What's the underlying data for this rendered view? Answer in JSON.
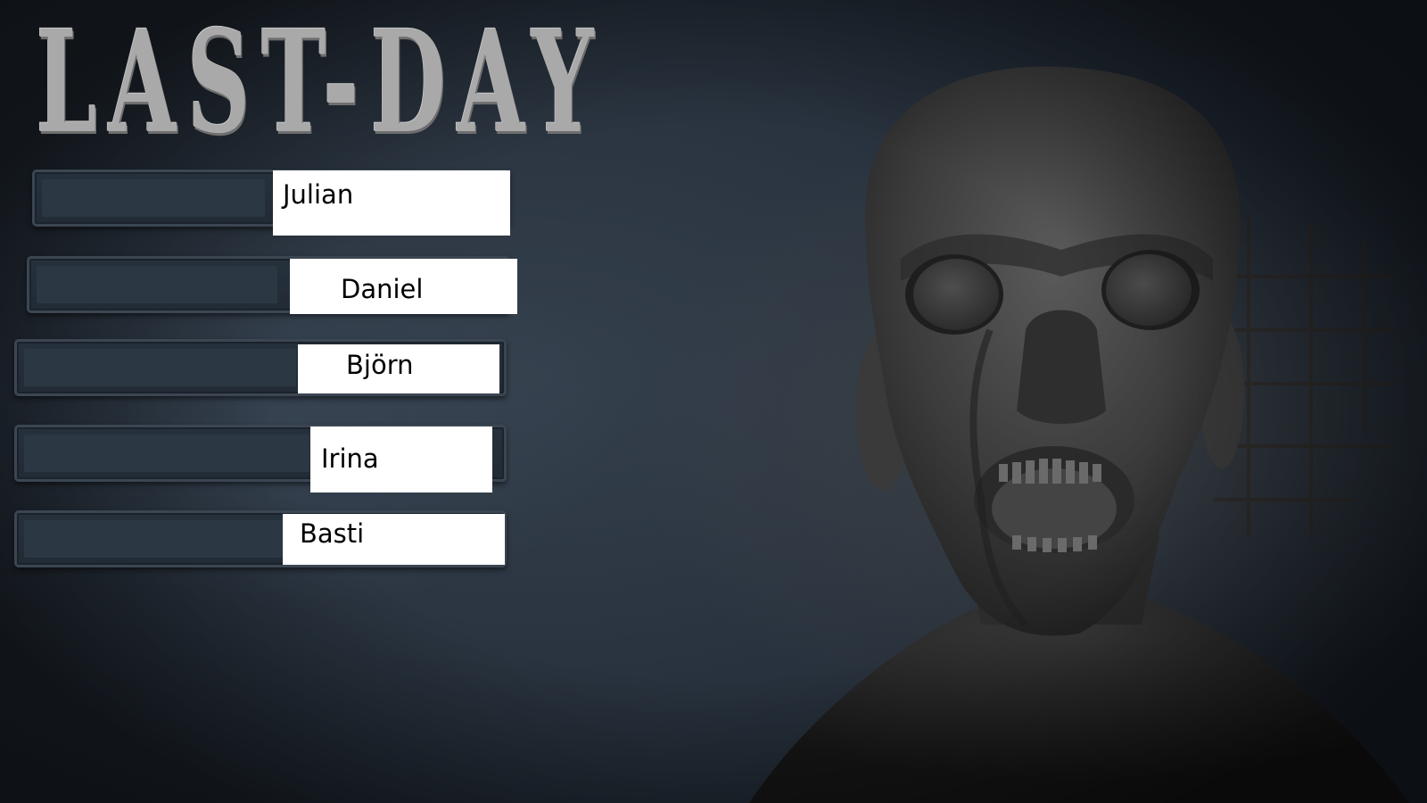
{
  "title": "LAST-DAY",
  "players": [
    {
      "name": "Julian"
    },
    {
      "name": "Daniel"
    },
    {
      "name": "Björn"
    },
    {
      "name": "Irina"
    },
    {
      "name": "Basti"
    }
  ],
  "colors": {
    "background": "#2a3440",
    "slot": "#26313c",
    "logo": "#a9a9a9",
    "name_box": "#ffffff"
  },
  "art": {
    "subject": "zombie-head-icon"
  }
}
